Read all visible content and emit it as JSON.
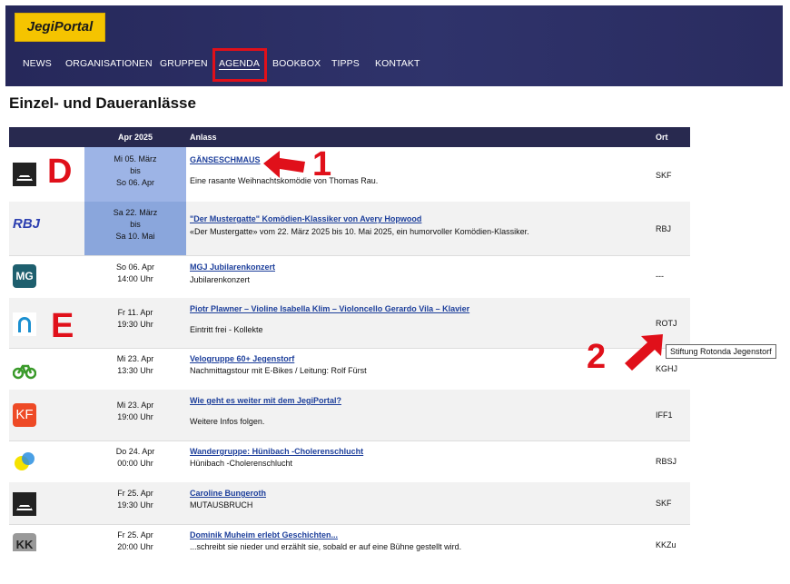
{
  "site": {
    "logo": "JegiPortal"
  },
  "nav": {
    "items": [
      "NEWS",
      "ORGANISATIONEN",
      "GRUPPEN",
      "AGENDA",
      "BOOKBOX",
      "TIPPS",
      "KONTAKT"
    ]
  },
  "page_title": "Einzel- und Daueranlässe",
  "table": {
    "headers": {
      "month": "Apr 2025",
      "event": "Anlass",
      "place": "Ort"
    },
    "rows": [
      {
        "date1": "Mi 05. März",
        "date2": "bis",
        "date3": "So 06. Apr",
        "title": "GÄNSESCHMAUS",
        "desc": "Eine rasante Weihnachtskomödie von Thomas Rau.",
        "ort": "SKF",
        "logo": "theater-icon"
      },
      {
        "date1": "Sa 22. März",
        "date2": "bis",
        "date3": "Sa 10. Mai",
        "title": "\"Der Mustergatte\" Komödien-Klassiker von Avery Hopwood",
        "desc": "«Der Mustergatte» vom 22. März 2025 bis 10. Mai 2025, ein humorvoller Komödien-Klassiker.",
        "ort": "RBJ",
        "logo": "RBJ"
      },
      {
        "date1": "So 06. Apr",
        "date2": "14:00 Uhr",
        "title": "MGJ Jubilarenkonzert",
        "desc": "Jubilarenkonzert",
        "ort": "---",
        "logo": "MG"
      },
      {
        "date1": "Fr 11. Apr",
        "date2": "19:30 Uhr",
        "title": "Piotr Plawner – Violine Isabella Klim – Violoncello Gerardo Vila – Klavier",
        "desc": "Eintritt frei - Kollekte",
        "ort": "ROTJ",
        "logo": "rotonda-icon"
      },
      {
        "date1": "Mi 23. Apr",
        "date2": "13:30 Uhr",
        "title": "Velogruppe 60+ Jegenstorf",
        "desc": "Nachmittagstour mit E-Bikes / Leitung: Rolf Fürst",
        "ort": "KGHJ",
        "logo": "bicycle-icon"
      },
      {
        "date1": "Mi 23. Apr",
        "date2": "19:00 Uhr",
        "title": "Wie geht es weiter mit dem JegiPortal?",
        "desc": "Weitere Infos folgen.",
        "ort": "IFF1",
        "logo": "KF"
      },
      {
        "date1": "Do 24. Apr",
        "date2": "00:00 Uhr",
        "title": "Wandergruppe: Hünibach -Cholerenschlucht",
        "desc": "Hünibach -Cholerenschlucht",
        "ort": "RBSJ",
        "logo": "circles-icon"
      },
      {
        "date1": "Fr 25. Apr",
        "date2": "19:30 Uhr",
        "title": "Caroline Bungeroth",
        "desc": "MUTAUSBRUCH",
        "ort": "SKF",
        "logo": "theater-icon"
      },
      {
        "date1": "Fr 25. Apr",
        "date2": "20:00 Uhr",
        "title": "Dominik Muheim erlebt Geschichten...",
        "desc": "...schreibt sie nieder und erzählt sie, sobald er auf eine Bühne gestellt wird.",
        "ort": "KKZu",
        "logo": "KK"
      }
    ]
  },
  "tooltip": "Stiftung Rotonda Jegenstorf",
  "annotations": {
    "one": "1",
    "two": "2",
    "d": "D",
    "e": "E"
  },
  "colors": {
    "accent": "#e0101a",
    "header": "#28294f",
    "highlight": "#9db4e6",
    "link": "#1d3f9b"
  }
}
